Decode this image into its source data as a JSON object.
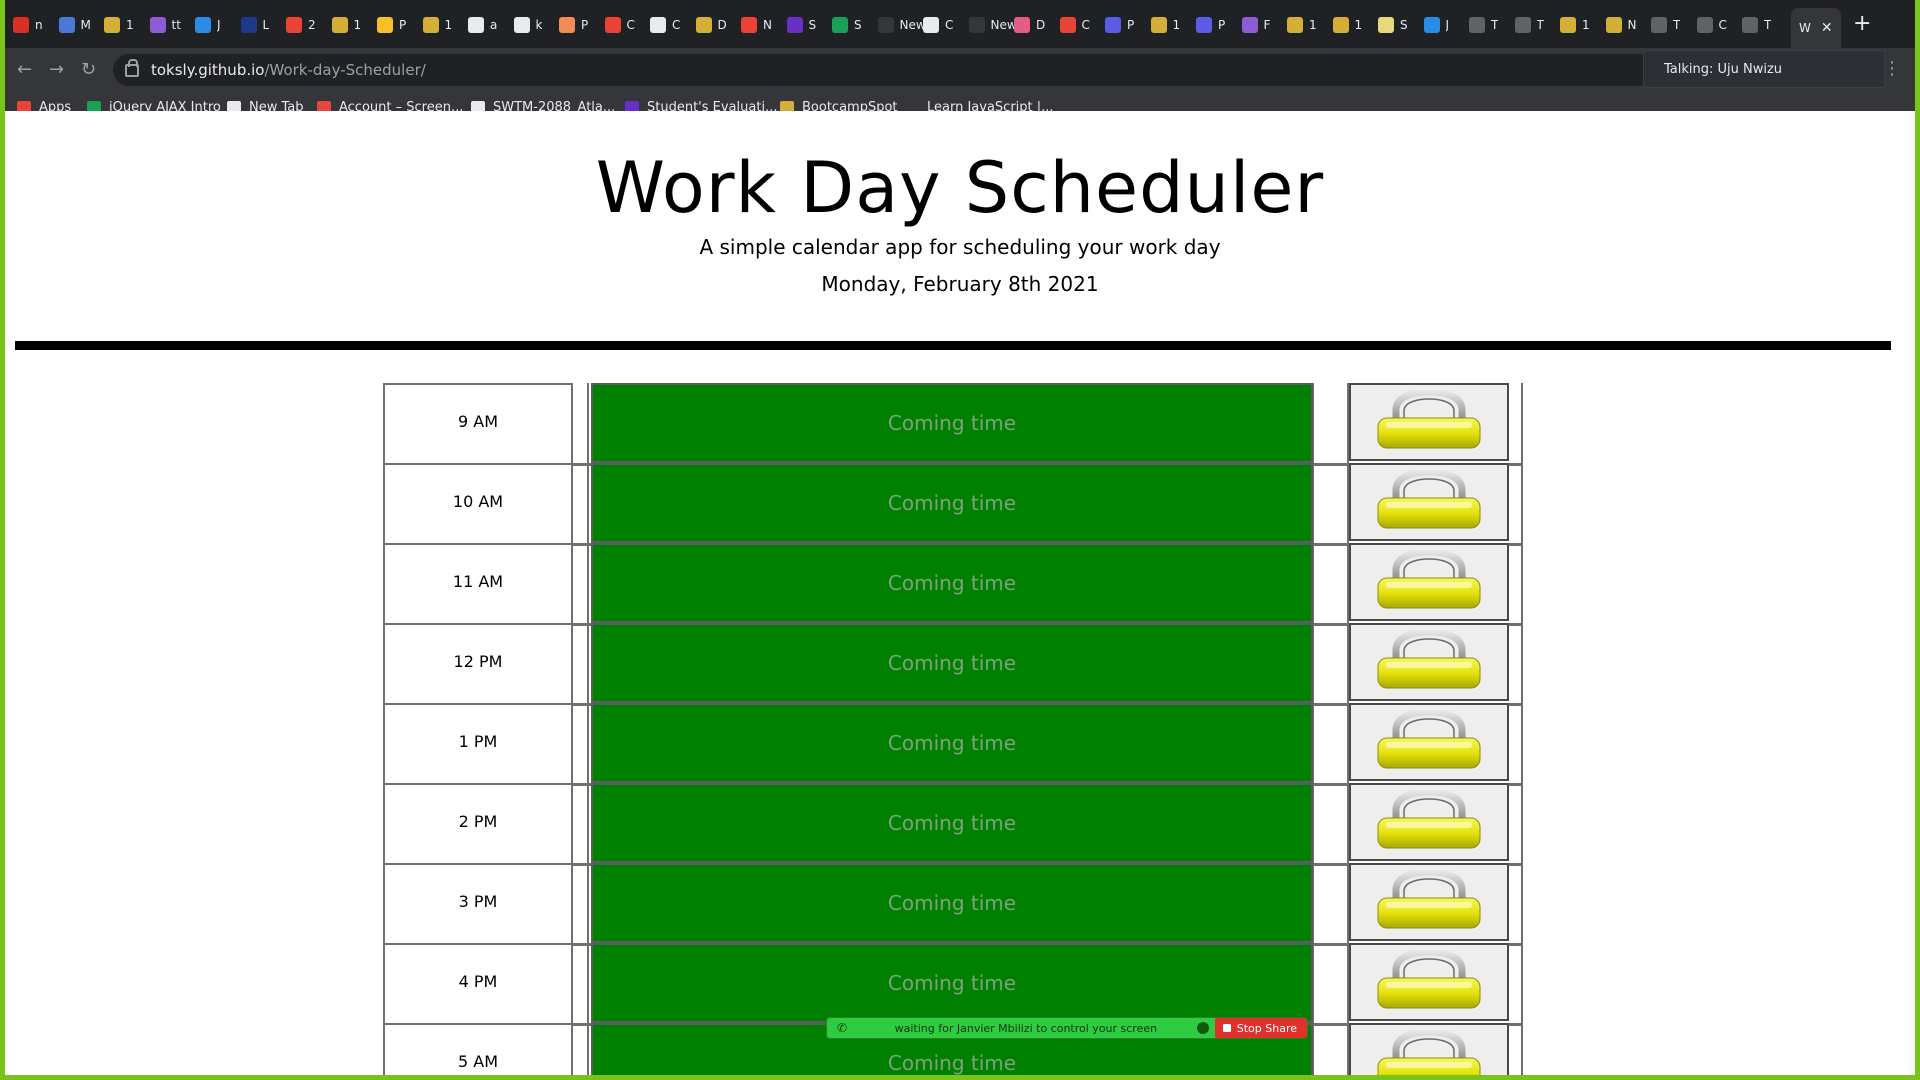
{
  "browser": {
    "tabs": [
      {
        "title": "n",
        "color": "#d93025"
      },
      {
        "title": "M",
        "color": "#4a78d6"
      },
      {
        "title": "1",
        "color": "#d4af37"
      },
      {
        "title": "tt",
        "color": "#8e5bd4"
      },
      {
        "title": "J",
        "color": "#2b8ce6"
      },
      {
        "title": "L",
        "color": "#1e3a8a"
      },
      {
        "title": "2",
        "color": "#ea4335"
      },
      {
        "title": "1",
        "color": "#d4af37"
      },
      {
        "title": "P",
        "color": "#f6c026"
      },
      {
        "title": "1",
        "color": "#d4af37"
      },
      {
        "title": "a",
        "color": "#e8eaed"
      },
      {
        "title": "k",
        "color": "#e8eaed"
      },
      {
        "title": "P",
        "color": "#f28b54"
      },
      {
        "title": "C",
        "color": "#ea4335"
      },
      {
        "title": "C",
        "color": "#e8eaed"
      },
      {
        "title": "D",
        "color": "#d4af37"
      },
      {
        "title": "N",
        "color": "#ea4335"
      },
      {
        "title": "S",
        "color": "#6b2fc9"
      },
      {
        "title": "S",
        "color": "#18a058"
      },
      {
        "title": "New",
        "color": "#35363a"
      },
      {
        "title": "C",
        "color": "#e8eaed"
      },
      {
        "title": "New",
        "color": "#35363a"
      },
      {
        "title": "D",
        "color": "#e45d88"
      },
      {
        "title": "C",
        "color": "#ea4335"
      },
      {
        "title": "P",
        "color": "#5b5be6"
      },
      {
        "title": "1",
        "color": "#d4af37"
      },
      {
        "title": "P",
        "color": "#5b5be6"
      },
      {
        "title": "F",
        "color": "#8e5bd4"
      },
      {
        "title": "1",
        "color": "#d4af37"
      },
      {
        "title": "1",
        "color": "#d4af37"
      },
      {
        "title": "S",
        "color": "#e8d87a"
      },
      {
        "title": "J",
        "color": "#2b8ce6"
      },
      {
        "title": "T",
        "color": "#5f6368"
      },
      {
        "title": "T",
        "color": "#5f6368"
      },
      {
        "title": "1",
        "color": "#d4af37"
      },
      {
        "title": "N",
        "color": "#d4af37"
      },
      {
        "title": "T",
        "color": "#5f6368"
      },
      {
        "title": "C",
        "color": "#5f6368"
      },
      {
        "title": "T",
        "color": "#5f6368"
      }
    ],
    "active_tab": {
      "title": "W"
    },
    "url_host": "toksly.github.io",
    "url_path": "/Work-day-Scheduler/",
    "bookmarks": [
      {
        "label": "Apps",
        "color": "#ea4335"
      },
      {
        "label": "jQuery AJAX Intro",
        "color": "#18a058"
      },
      {
        "label": "New Tab",
        "color": "#e8eaed"
      },
      {
        "label": "Account – Screen...",
        "color": "#e8453c"
      },
      {
        "label": "SWTM-2088_Atla...",
        "color": "#e8eaed"
      },
      {
        "label": "Student's Evaluati...",
        "color": "#6b2fc9"
      },
      {
        "label": "BootcampSpot",
        "color": "#d4af37"
      },
      {
        "label": "Learn JavaScript |...",
        "color": "#35363a"
      }
    ],
    "talking_label": "Talking: Uju Nwizu"
  },
  "page": {
    "title": "Work Day Scheduler",
    "subtitle": "A simple calendar app for scheduling your work day",
    "date": "Monday, February 8th 2021"
  },
  "schedule": {
    "rows": [
      {
        "hour": "9 AM",
        "status": "Coming time"
      },
      {
        "hour": "10 AM",
        "status": "Coming time"
      },
      {
        "hour": "11 AM",
        "status": "Coming time"
      },
      {
        "hour": "12 PM",
        "status": "Coming time"
      },
      {
        "hour": "1 PM",
        "status": "Coming time"
      },
      {
        "hour": "2 PM",
        "status": "Coming time"
      },
      {
        "hour": "3 PM",
        "status": "Coming time"
      },
      {
        "hour": "4 PM",
        "status": "Coming time"
      },
      {
        "hour": "5 AM",
        "status": "Coming time"
      }
    ],
    "future_color": "#008000",
    "save_icon": "lock-icon"
  },
  "share_bar": {
    "message": "waiting for Janvier Mbilizi to control your screen",
    "stop_label": "Stop Share"
  }
}
